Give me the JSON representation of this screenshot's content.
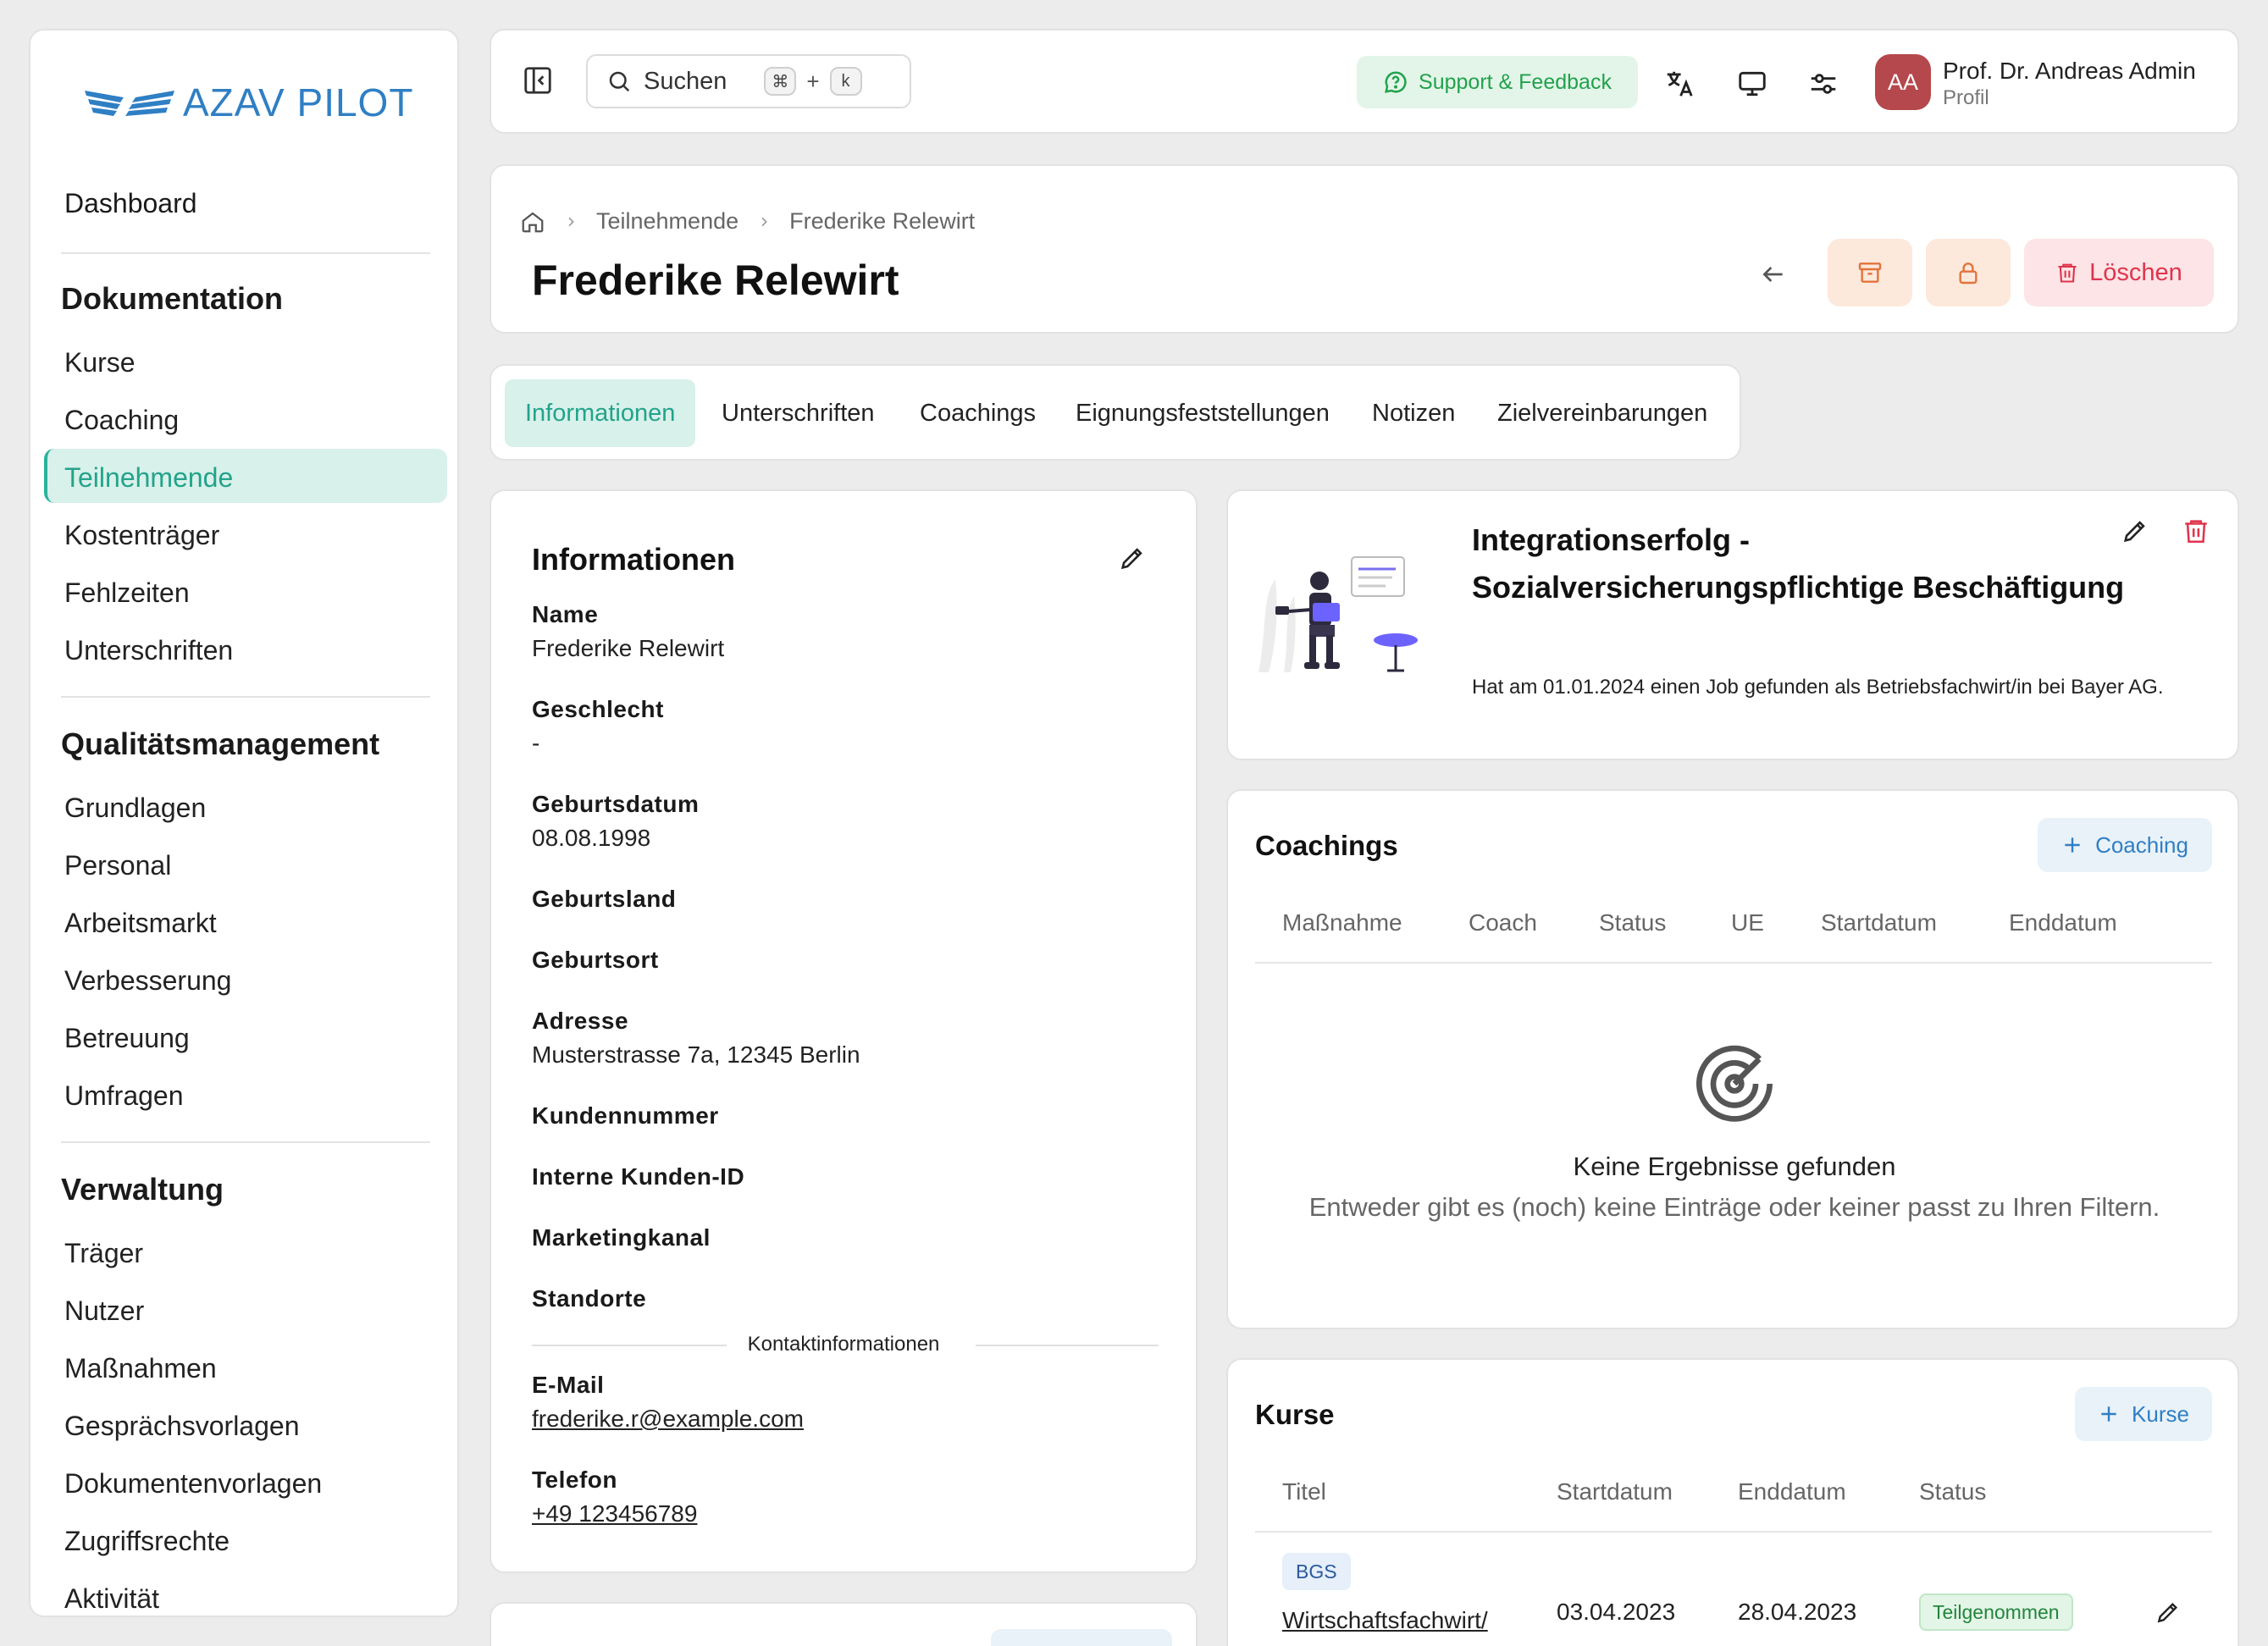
{
  "brand": {
    "name": "AZAV PILOT",
    "color": "#2f7fc4",
    "accent": "#23a38b"
  },
  "sidebar": {
    "dashboard": "Dashboard",
    "groups": [
      {
        "title": "Dokumentation",
        "items": [
          "Kurse",
          "Coaching",
          "Teilnehmende",
          "Kostenträger",
          "Fehlzeiten",
          "Unterschriften"
        ]
      },
      {
        "title": "Qualitätsmanagement",
        "items": [
          "Grundlagen",
          "Personal",
          "Arbeitsmarkt",
          "Verbesserung",
          "Betreuung",
          "Umfragen"
        ]
      },
      {
        "title": "Verwaltung",
        "items": [
          "Träger",
          "Nutzer",
          "Maßnahmen",
          "Gesprächsvorlagen",
          "Dokumentenvorlagen",
          "Zugriffsrechte",
          "Aktivität"
        ]
      }
    ],
    "active_item": "Teilnehmende"
  },
  "topbar": {
    "search_label": "Suchen",
    "shortcut_key1": "⌘",
    "shortcut_plus": "+",
    "shortcut_key2": "k",
    "support_label": "Support & Feedback",
    "user_initials": "AA",
    "user_name": "Prof. Dr. Andreas Admin",
    "user_role": "Profil"
  },
  "header": {
    "breadcrumb": [
      "Teilnehmende",
      "Frederike Relewirt"
    ],
    "title": "Frederike Relewirt",
    "delete_label": "Löschen"
  },
  "tabs": [
    "Informationen",
    "Unterschriften",
    "Coachings",
    "Eignungsfeststellungen",
    "Notizen",
    "Zielvereinbarungen"
  ],
  "info": {
    "title": "Informationen",
    "fields": [
      {
        "label": "Name",
        "value": "Frederike Relewirt"
      },
      {
        "label": "Geschlecht",
        "value": "-"
      },
      {
        "label": "Geburtsdatum",
        "value": "08.08.1998"
      },
      {
        "label": "Geburtsland",
        "value": ""
      },
      {
        "label": "Geburtsort",
        "value": ""
      },
      {
        "label": "Adresse",
        "value": "Musterstrasse 7a, 12345 Berlin"
      },
      {
        "label": "Kundennummer",
        "value": ""
      },
      {
        "label": "Interne Kunden-ID",
        "value": ""
      },
      {
        "label": "Marketingkanal",
        "value": ""
      },
      {
        "label": "Standorte",
        "value": ""
      }
    ],
    "contact_divider": "Kontaktinformationen",
    "email_label": "E-Mail",
    "email_value": "frederike.r@example.com",
    "phone_label": "Telefon",
    "phone_value": "+49 123456789"
  },
  "integration": {
    "title": "Integrationserfolg - Sozialversicherungspflichtige Beschäftigung",
    "text": "Hat am 01.01.2024 einen Job gefunden als Betriebsfachwirt/in bei Bayer AG."
  },
  "coachings": {
    "title": "Coachings",
    "add_label": "Coaching",
    "columns": [
      "Maßnahme",
      "Coach",
      "Status",
      "UE",
      "Startdatum",
      "Enddatum"
    ],
    "empty_title": "Keine Ergebnisse gefunden",
    "empty_sub": "Entweder gibt es (noch) keine Einträge oder keiner passt zu Ihren Filtern."
  },
  "kurse": {
    "title": "Kurse",
    "add_label": "Kurse",
    "columns": [
      "Titel",
      "Startdatum",
      "Enddatum",
      "Status"
    ],
    "rows": [
      {
        "badge": "BGS",
        "title": "Wirtschaftsfachwirt/",
        "start": "03.04.2023",
        "end": "28.04.2023",
        "status": "Teilgenommen"
      }
    ]
  }
}
